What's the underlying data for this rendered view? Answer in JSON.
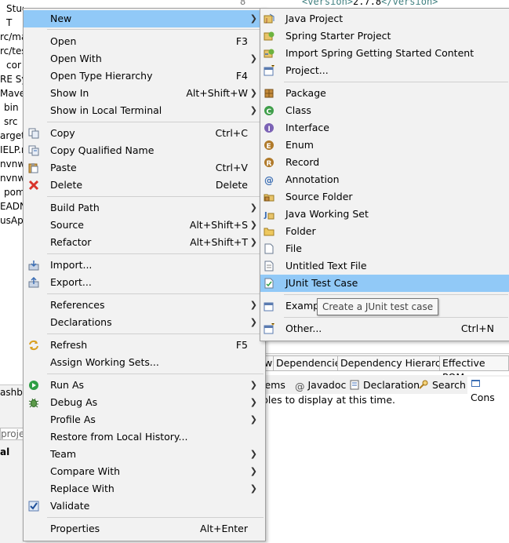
{
  "background": {
    "tree_rows": [
      "Study.java",
      "T",
      "rc/ma",
      "rc/tes",
      "cor",
      "RE Sy:",
      "Maven",
      "bin",
      "src",
      "arget",
      "IELP.m",
      "nvnw",
      "nvnw.",
      "pom",
      "EADN",
      "usAp"
    ],
    "editor_line_number": "8",
    "editor_code_open_tag": "<version>",
    "editor_code_text": "2.7.8",
    "editor_code_close_tag": "</version>",
    "pom_tabs": [
      "w",
      "Dependencies",
      "Dependency Hierarchy",
      "Effective POM"
    ],
    "view_tabs": [
      "lems",
      "Javadoc",
      "Declaration",
      "Search",
      "Cons"
    ],
    "view_message": "bles to display at this time.",
    "left_fragments": [
      "ashbo",
      "proje",
      "al"
    ]
  },
  "context_menu": {
    "items": [
      {
        "label": "New",
        "shortcut": "",
        "arrow": true,
        "icon": "",
        "highlighted": true
      },
      {
        "label": "Open",
        "shortcut": "F3",
        "arrow": false,
        "icon": ""
      },
      {
        "label": "Open With",
        "shortcut": "",
        "arrow": true,
        "icon": ""
      },
      {
        "label": "Open Type Hierarchy",
        "shortcut": "F4",
        "arrow": false,
        "icon": ""
      },
      {
        "label": "Show In",
        "shortcut": "Alt+Shift+W",
        "arrow": true,
        "icon": ""
      },
      {
        "label": "Show in Local Terminal",
        "shortcut": "",
        "arrow": true,
        "icon": ""
      },
      {
        "label": "Copy",
        "shortcut": "Ctrl+C",
        "arrow": false,
        "icon": "copy-icon"
      },
      {
        "label": "Copy Qualified Name",
        "shortcut": "",
        "arrow": false,
        "icon": "copy-qualified-icon"
      },
      {
        "label": "Paste",
        "shortcut": "Ctrl+V",
        "arrow": false,
        "icon": "paste-icon"
      },
      {
        "label": "Delete",
        "shortcut": "Delete",
        "arrow": false,
        "icon": "delete-icon"
      },
      {
        "label": "Build Path",
        "shortcut": "",
        "arrow": true,
        "icon": ""
      },
      {
        "label": "Source",
        "shortcut": "Alt+Shift+S",
        "arrow": true,
        "icon": ""
      },
      {
        "label": "Refactor",
        "shortcut": "Alt+Shift+T",
        "arrow": true,
        "icon": ""
      },
      {
        "label": "Import...",
        "shortcut": "",
        "arrow": false,
        "icon": "import-icon"
      },
      {
        "label": "Export...",
        "shortcut": "",
        "arrow": false,
        "icon": "export-icon"
      },
      {
        "label": "References",
        "shortcut": "",
        "arrow": true,
        "icon": ""
      },
      {
        "label": "Declarations",
        "shortcut": "",
        "arrow": true,
        "icon": ""
      },
      {
        "label": "Refresh",
        "shortcut": "F5",
        "arrow": false,
        "icon": "refresh-icon"
      },
      {
        "label": "Assign Working Sets...",
        "shortcut": "",
        "arrow": false,
        "icon": ""
      },
      {
        "label": "Run As",
        "shortcut": "",
        "arrow": true,
        "icon": "run-icon"
      },
      {
        "label": "Debug As",
        "shortcut": "",
        "arrow": true,
        "icon": "debug-icon"
      },
      {
        "label": "Profile As",
        "shortcut": "",
        "arrow": true,
        "icon": ""
      },
      {
        "label": "Restore from Local History...",
        "shortcut": "",
        "arrow": false,
        "icon": ""
      },
      {
        "label": "Team",
        "shortcut": "",
        "arrow": true,
        "icon": ""
      },
      {
        "label": "Compare With",
        "shortcut": "",
        "arrow": true,
        "icon": ""
      },
      {
        "label": "Replace With",
        "shortcut": "",
        "arrow": true,
        "icon": ""
      },
      {
        "label": "Validate",
        "shortcut": "",
        "arrow": false,
        "icon": "checkbox-checked-icon"
      },
      {
        "label": "Properties",
        "shortcut": "Alt+Enter",
        "arrow": false,
        "icon": ""
      }
    ]
  },
  "new_submenu": {
    "items": [
      {
        "label": "Java Project",
        "icon": "java-project-icon"
      },
      {
        "label": "Spring Starter Project",
        "icon": "spring-starter-icon"
      },
      {
        "label": "Import Spring Getting Started Content",
        "icon": "spring-import-icon"
      },
      {
        "label": "Project...",
        "icon": "project-icon"
      },
      {
        "label": "Package",
        "icon": "package-icon"
      },
      {
        "label": "Class",
        "icon": "class-icon"
      },
      {
        "label": "Interface",
        "icon": "interface-icon"
      },
      {
        "label": "Enum",
        "icon": "enum-icon"
      },
      {
        "label": "Record",
        "icon": "record-icon"
      },
      {
        "label": "Annotation",
        "icon": "annotation-icon"
      },
      {
        "label": "Source Folder",
        "icon": "source-folder-icon"
      },
      {
        "label": "Java Working Set",
        "icon": "working-set-icon"
      },
      {
        "label": "Folder",
        "icon": "folder-icon"
      },
      {
        "label": "File",
        "icon": "file-icon"
      },
      {
        "label": "Untitled Text File",
        "icon": "text-file-icon"
      },
      {
        "label": "JUnit Test Case",
        "icon": "junit-icon",
        "highlighted": true
      },
      {
        "label": "Exampl",
        "icon": "example-icon"
      },
      {
        "label": "Other...",
        "icon": "other-icon",
        "shortcut": "Ctrl+N"
      }
    ],
    "tooltip": "Create a JUnit test case"
  },
  "colors": {
    "highlight": "#91c9f7",
    "menu_bg": "#f2f2f2",
    "java_green": "#2e8b57",
    "delete_red": "#d9342b"
  }
}
